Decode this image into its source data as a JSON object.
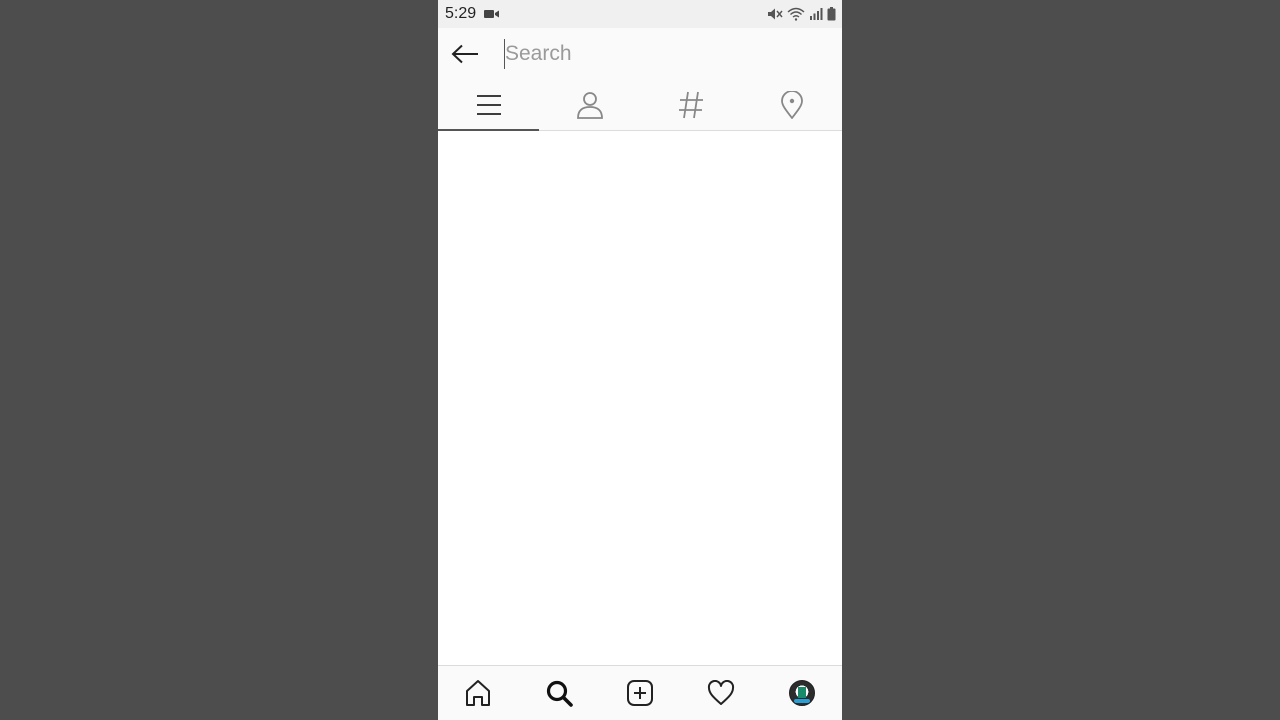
{
  "status_bar": {
    "time": "5:29",
    "icons": [
      "video-camera-icon",
      "mute-icon",
      "wifi-icon",
      "signal-icon",
      "battery-icon"
    ]
  },
  "search": {
    "placeholder": "Search",
    "value": ""
  },
  "tabs": [
    {
      "id": "top",
      "icon": "list-icon",
      "active": true
    },
    {
      "id": "accounts",
      "icon": "person-icon",
      "active": false
    },
    {
      "id": "tags",
      "icon": "hashtag-icon",
      "active": false
    },
    {
      "id": "places",
      "icon": "location-pin-icon",
      "active": false
    }
  ],
  "bottom_nav": [
    {
      "id": "home",
      "icon": "home-icon"
    },
    {
      "id": "search",
      "icon": "search-icon",
      "active": true
    },
    {
      "id": "new-post",
      "icon": "add-post-icon"
    },
    {
      "id": "activity",
      "icon": "heart-icon"
    },
    {
      "id": "profile",
      "icon": "avatar"
    }
  ],
  "colors": {
    "background": "#4d4d4d",
    "header": "#fafafa",
    "status_bar": "#f0f0f0",
    "placeholder": "#9a9a9a",
    "tab_indicator": "#555555"
  }
}
